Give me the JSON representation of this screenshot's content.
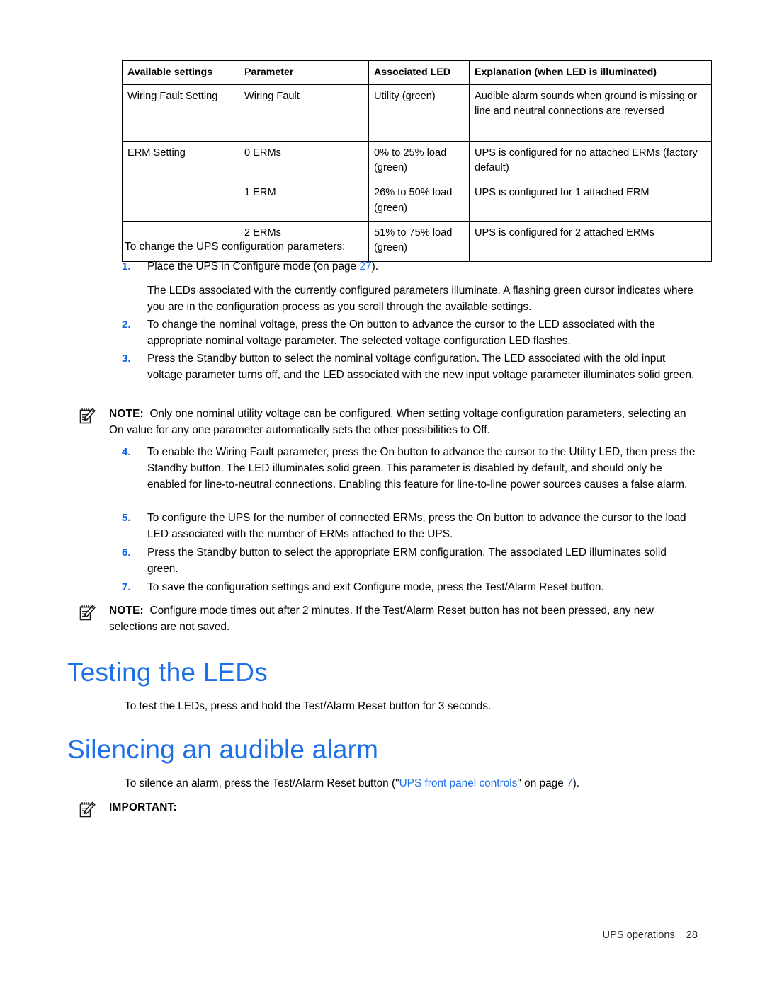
{
  "document": {
    "footer_label": "UPS operations",
    "page_number": "28"
  },
  "table": {
    "headers": [
      "Available settings",
      "Parameter",
      "Associated LED",
      "Explanation (when LED is illuminated)"
    ],
    "rows": [
      {
        "setting": "Wiring Fault Setting",
        "parameter": "Wiring Fault",
        "led": "Utility (green)",
        "explanation": "Audible alarm sounds when ground is missing or line and neutral connections are reversed"
      },
      {
        "setting": "ERM Setting",
        "parameter": "0 ERMs",
        "led": "0% to 25% load (green)",
        "explanation": "UPS is configured for no attached ERMs (factory default)"
      },
      {
        "setting": "",
        "parameter": "1 ERM",
        "led": "26% to 50% load (green)",
        "explanation": "UPS is configured for 1 attached ERM"
      },
      {
        "setting": "",
        "parameter": "2 ERMs",
        "led": "51% to 75% load (green)",
        "explanation": "UPS is configured for 2 attached ERMs"
      }
    ]
  },
  "content": {
    "intro": "To change the UPS configuration parameters:",
    "step1": {
      "number": "1.",
      "text_before": "Place the UPS in Configure mode (on page ",
      "page_ref": "27",
      "text_after": ")."
    },
    "step1_note": "The LEDs associated with the currently configured parameters illuminate. A flashing green cursor indicates where you are in the configuration process as you scroll through the available settings.",
    "step2": {
      "number": "2.",
      "text": "To change the nominal voltage, press the On button to advance the cursor to the LED associated with the appropriate nominal voltage parameter. The selected voltage configuration LED flashes."
    },
    "step3": {
      "number": "3.",
      "text": "Press the Standby button to select the nominal voltage configuration. The LED associated with the old input voltage parameter turns off, and the LED associated with the new input voltage parameter illuminates solid green."
    },
    "note1": {
      "icon": "note-pad-pencil-icon",
      "label": "NOTE:",
      "text": "Only one nominal utility voltage can be configured. When setting voltage configuration parameters, selecting an On value for any one parameter automatically sets the other possibilities to Off."
    },
    "step4": {
      "number": "4.",
      "text": "To enable the Wiring Fault parameter, press the On button to advance the cursor to the Utility LED, then press the Standby button. The LED illuminates solid green. This parameter is disabled by default, and should only be enabled for line-to-neutral connections. Enabling this feature for line-to-line power sources causes a false alarm."
    },
    "step5": {
      "number": "5.",
      "text": "To configure the UPS for the number of connected ERMs, press the On button to advance the cursor to the load LED associated with the number of ERMs attached to the UPS."
    },
    "step6": {
      "number": "6.",
      "text": "Press the Standby button to select the appropriate ERM configuration. The associated LED illuminates solid green."
    },
    "step7": {
      "number": "7.",
      "text": "To save the configuration settings and exit Configure mode, press the Test/Alarm Reset button."
    },
    "note2": {
      "icon": "note-pad-pencil-icon",
      "label": "NOTE:",
      "text": "Configure mode times out after 2 minutes. If the Test/Alarm Reset button has not been pressed, any new selections are not saved."
    },
    "heading_testing": "Testing the LEDs",
    "testing_body": "To test the LEDs, press and hold the Test/Alarm Reset button for 3 seconds.",
    "heading_silencing": "Silencing an audible alarm",
    "silencing_body": {
      "text_before": "To silence an alarm, press the Test/Alarm Reset button (\"",
      "link": "UPS front panel controls",
      "text_mid": "\" on page ",
      "page_ref": "7",
      "text_after": ")."
    },
    "important": {
      "icon": "note-pad-pencil-icon",
      "label": "IMPORTANT:"
    }
  },
  "colors": {
    "heading_blue": "#1D70E8",
    "link_blue": "#1D70E8",
    "step_number_blue": "#0A63E0",
    "text_black": "#000000"
  }
}
